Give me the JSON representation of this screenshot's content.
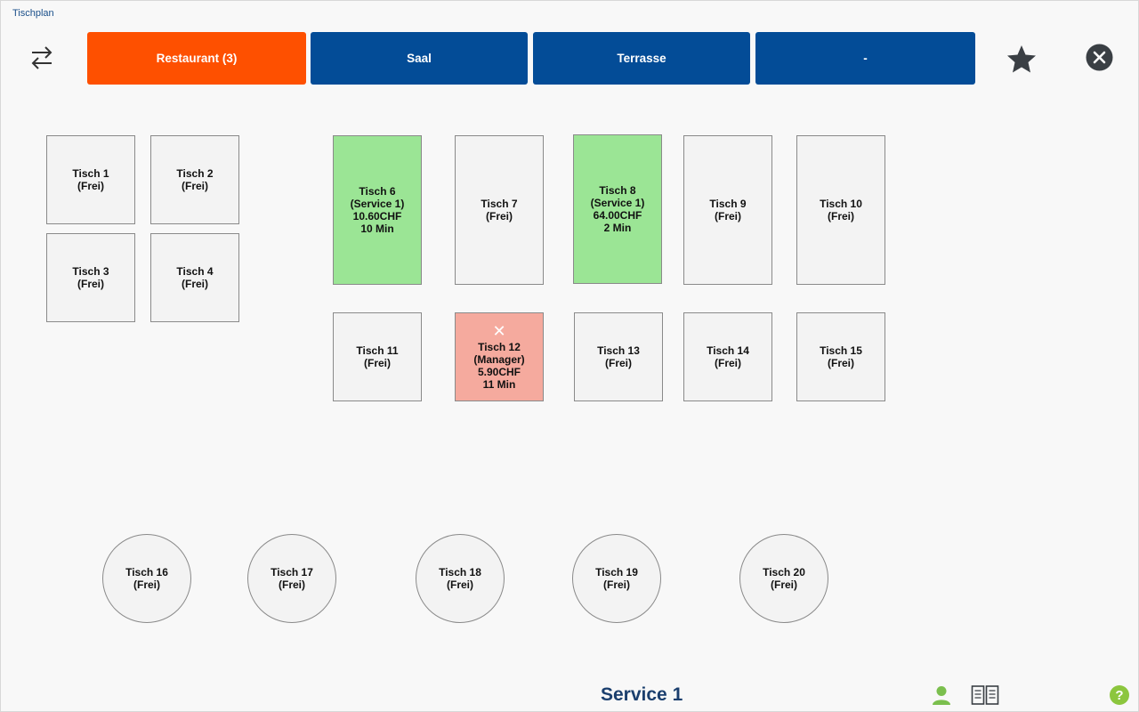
{
  "window": {
    "title": "Tischplan"
  },
  "tabs": [
    {
      "label": "Restaurant (3)",
      "color": "#fe5000"
    },
    {
      "label": "Saal",
      "color": "#034c97"
    },
    {
      "label": "Terrasse",
      "color": "#034c97"
    },
    {
      "label": "-",
      "color": "#034c97"
    }
  ],
  "icons": {
    "swap": "swap-arrows-icon",
    "favorite": "star-icon",
    "close": "close-icon",
    "user": "user-icon",
    "book": "book-icon",
    "help": "help-icon"
  },
  "tables": [
    {
      "lines": [
        "Tisch 1",
        "(Frei)"
      ],
      "status": "free"
    },
    {
      "lines": [
        "Tisch 2",
        "(Frei)"
      ],
      "status": "free"
    },
    {
      "lines": [
        "Tisch 3",
        "(Frei)"
      ],
      "status": "free"
    },
    {
      "lines": [
        "Tisch 4",
        "(Frei)"
      ],
      "status": "free"
    },
    {
      "lines": [
        "Tisch 6",
        "(Service 1)",
        "10.60CHF",
        "10 Min"
      ],
      "status": "occupied"
    },
    {
      "lines": [
        "Tisch 7",
        "(Frei)"
      ],
      "status": "free"
    },
    {
      "lines": [
        "Tisch 8",
        "(Service 1)",
        "64.00CHF",
        "2 Min"
      ],
      "status": "occupied"
    },
    {
      "lines": [
        "Tisch 9",
        "(Frei)"
      ],
      "status": "free"
    },
    {
      "lines": [
        "Tisch 10",
        "(Frei)"
      ],
      "status": "free"
    },
    {
      "lines": [
        "Tisch 11",
        "(Frei)"
      ],
      "status": "free"
    },
    {
      "lines": [
        "Tisch 12",
        "(Manager)",
        "5.90CHF",
        "11 Min"
      ],
      "status": "other",
      "mark": "✕"
    },
    {
      "lines": [
        "Tisch 13",
        "(Frei)"
      ],
      "status": "free"
    },
    {
      "lines": [
        "Tisch 14",
        "(Frei)"
      ],
      "status": "free"
    },
    {
      "lines": [
        "Tisch 15",
        "(Frei)"
      ],
      "status": "free"
    },
    {
      "lines": [
        "Tisch 16",
        "(Frei)"
      ],
      "status": "free"
    },
    {
      "lines": [
        "Tisch 17",
        "(Frei)"
      ],
      "status": "free"
    },
    {
      "lines": [
        "Tisch 18",
        "(Frei)"
      ],
      "status": "free"
    },
    {
      "lines": [
        "Tisch 19",
        "(Frei)"
      ],
      "status": "free"
    },
    {
      "lines": [
        "Tisch 20",
        "(Frei)"
      ],
      "status": "free"
    }
  ],
  "footer": {
    "user": "Service 1",
    "help_glyph": "?"
  },
  "colors": {
    "free": "#f3f3f3",
    "occupied": "#9be595",
    "other": "#f5aa9e",
    "accent": "#1b3f6e"
  }
}
